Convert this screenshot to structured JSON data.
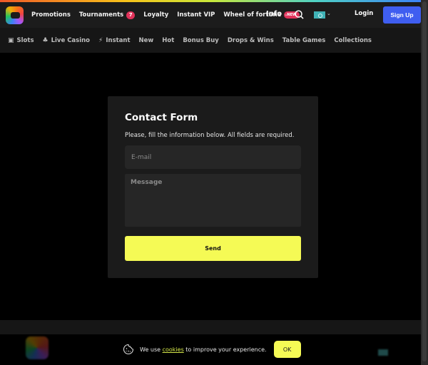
{
  "header": {
    "nav": [
      {
        "label": "Promotions"
      },
      {
        "label": "Tournaments",
        "badge": "7"
      },
      {
        "label": "Loyalty"
      },
      {
        "label": "Instant VIP"
      },
      {
        "label": "Wheel of fortune",
        "badge": "NEW"
      }
    ],
    "info_label": "Info",
    "login_label": "Login",
    "signup_label": "Sign Up",
    "colors": {
      "signup": "#3f5ef0",
      "badge": "#e0325a"
    }
  },
  "subnav": {
    "items": [
      {
        "label": "Slots",
        "icon": "slot-machine-icon"
      },
      {
        "label": "Live Casino",
        "icon": "club-icon"
      },
      {
        "label": "Instant",
        "icon": "lightning-icon"
      },
      {
        "label": "New"
      },
      {
        "label": "Hot"
      },
      {
        "label": "Bonus Buy"
      },
      {
        "label": "Drops & Wins"
      },
      {
        "label": "Table Games"
      },
      {
        "label": "Collections"
      }
    ]
  },
  "form": {
    "title": "Contact Form",
    "description": "Please, fill the information below. All fields are required.",
    "email_placeholder": "E-mail",
    "message_placeholder": "Message",
    "send_label": "Send",
    "colors": {
      "send": "#f5fa55"
    }
  },
  "cookie": {
    "prefix": "We use ",
    "link": "cookies",
    "suffix": " to improve your experience.",
    "ok_label": "OK"
  }
}
